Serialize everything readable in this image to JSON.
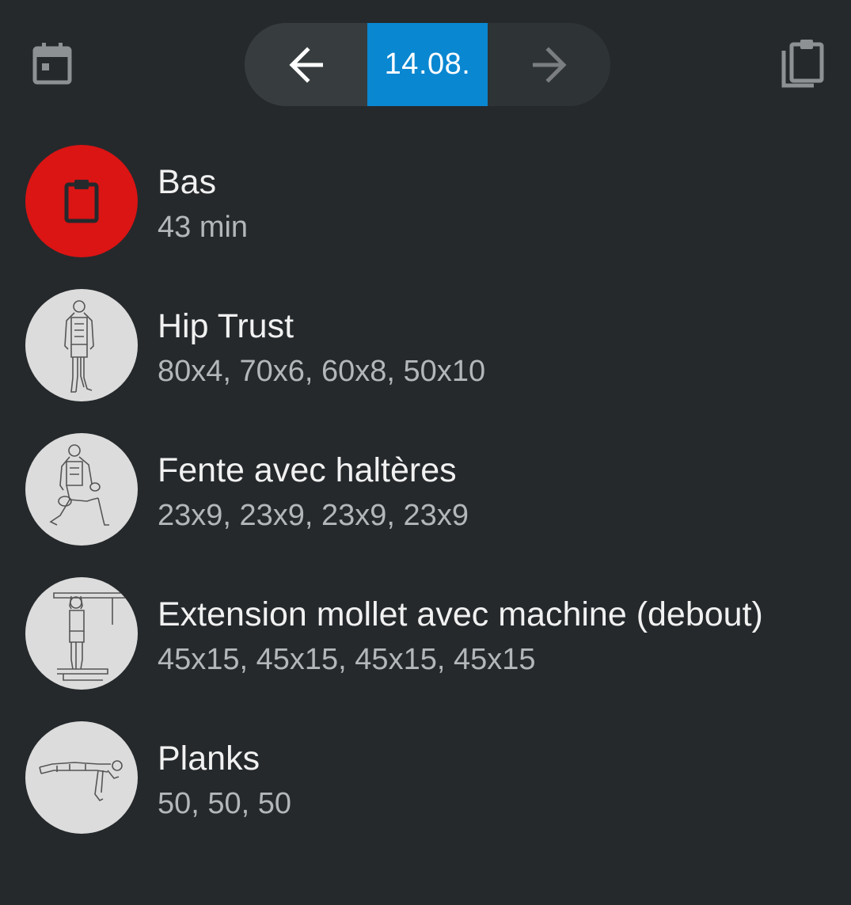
{
  "header": {
    "calendar_icon": "calendar-icon",
    "clipboard_icon": "clipboard-copy-icon",
    "date_label": "14.08.",
    "prev_icon": "arrow-left-icon",
    "next_icon": "arrow-right-icon"
  },
  "colors": {
    "background": "#25292c",
    "accent": "#0a87d1",
    "session_badge": "#db1414"
  },
  "items": [
    {
      "title": "Bas",
      "subtitle": "43 min",
      "icon": "clipboard-icon"
    },
    {
      "title": "Hip Trust",
      "subtitle": "80x4, 70x6, 60x8, 50x10",
      "icon": "standing-figure-icon"
    },
    {
      "title": "Fente avec haltères",
      "subtitle": "23x9, 23x9, 23x9, 23x9",
      "icon": "lunge-figure-icon"
    },
    {
      "title": "Extension mollet avec machine (debout)",
      "subtitle": "45x15, 45x15, 45x15, 45x15",
      "icon": "calf-raise-figure-icon"
    },
    {
      "title": "Planks",
      "subtitle": "50, 50, 50",
      "icon": "plank-figure-icon"
    }
  ]
}
